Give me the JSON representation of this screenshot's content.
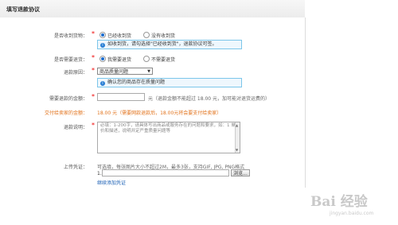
{
  "header": {
    "title": "填写退款协议"
  },
  "form": {
    "received": {
      "label": "是否收到货物：",
      "options": [
        "已经收到货",
        "没有收到货"
      ],
      "tip": "如收到货，请勾选择\"已经收到货\"，退款协议可签。"
    },
    "return_goods": {
      "label": "是否需要退货：",
      "options": [
        "我需要退货",
        "不需要退货"
      ]
    },
    "reason": {
      "label": "退款原因：",
      "selected": "商品质量问题",
      "tip": "确认您的商品存在质量问题"
    },
    "amount": {
      "label": "需要退款的金额：",
      "hint": "元（退款金额不能超过 18.00 元，加可能对退货运费的）"
    },
    "paid": {
      "label": "交付给卖家的金额：",
      "text": "18.00 元（需要网款退款后，18.00元将会要支付给卖家）"
    },
    "desc": {
      "label": "退款说明：",
      "placeholder": "必填：1-200字，请具体写出商品或服务存在的问题和要求，如：1 单价和描述，说明并定严重质量问题等"
    },
    "upload": {
      "label": "上传凭证：",
      "hint": "可选填，每张图片大小不超过2M，最多3张，支持GIF, JPG, PNG格式",
      "index": "1.",
      "browse": "浏览...",
      "add_more": "继续添加凭证"
    }
  },
  "watermark": {
    "text": "Bai 经验",
    "sub": "jingyan.baidu.com"
  }
}
